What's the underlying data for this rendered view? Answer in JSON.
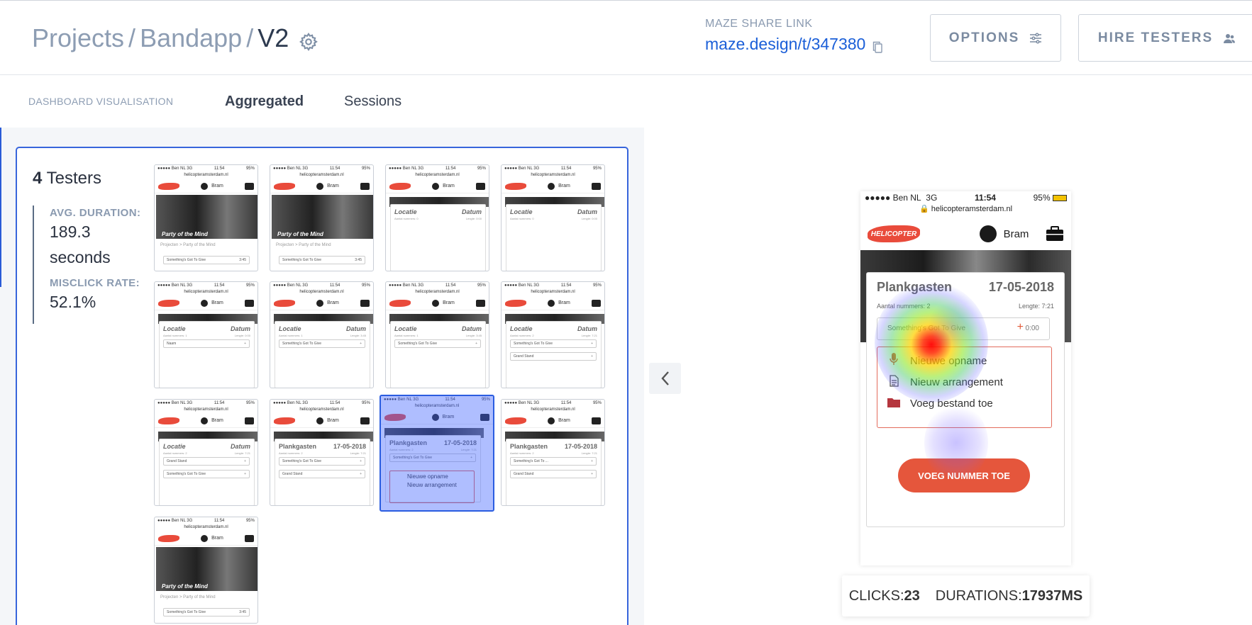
{
  "header": {
    "breadcrumb": [
      "Projects",
      "Bandapp",
      "V2"
    ],
    "breadcrumb_sep": "/",
    "share_label": "MAZE SHARE LINK",
    "share_link": "maze.design/t/347380",
    "options_label": "OPTIONS",
    "hire_label": "HIRE TESTERS"
  },
  "subnav": {
    "section_label": "DASHBOARD VISUALISATION",
    "tabs": [
      {
        "label": "Aggregated",
        "active": true
      },
      {
        "label": "Sessions",
        "active": false
      }
    ]
  },
  "summary": {
    "testers_count": "4",
    "testers_label": "Testers",
    "avg_duration_label": "AVG. DURATION:",
    "avg_duration_value": "189.3",
    "avg_duration_unit": "seconds",
    "misclick_label": "MISCLICK RATE:",
    "misclick_value": "52.1%"
  },
  "thumbnail_common": {
    "carrier": "●●●●● Ben NL",
    "network": "3G",
    "time": "11:54",
    "battery": "95%",
    "url": "helicopteramsterdam.nl",
    "user": "Bram"
  },
  "thumbnails": [
    {
      "type": "hero",
      "caption": "Party of the Mind",
      "breadcrumb": "Projecten > Party of the Mind",
      "row": "Something's Got To Give",
      "row_time": "3:45"
    },
    {
      "type": "hero",
      "caption": "Party of the Mind",
      "breadcrumb": "Projecten > Party of the Mind",
      "row": "Something's Got To Give",
      "row_time": "3:45"
    },
    {
      "type": "card",
      "title": "Locatie",
      "date": "Datum",
      "sub": "Aantal nummers: 0",
      "len": "Lengte: 0:00",
      "rows": []
    },
    {
      "type": "card",
      "title": "Locatie",
      "date": "Datum",
      "sub": "Aantal nummers: 0",
      "len": "Lengte: 0:00",
      "rows": []
    },
    {
      "type": "card",
      "title": "Locatie",
      "date": "Datum",
      "sub": "Aantal nummers: 1",
      "len": "Lengte: 0:00",
      "rows": [
        "Naam"
      ]
    },
    {
      "type": "card",
      "title": "Locatie",
      "date": "Datum",
      "sub": "Aantal nummers: 1",
      "len": "Lengte: 3:45",
      "rows": [
        "Something's Got To Give"
      ]
    },
    {
      "type": "card",
      "title": "Locatie",
      "date": "Datum",
      "sub": "Aantal nummers: 1",
      "len": "Lengte: 3:45",
      "rows": [
        "Something's Got To Give"
      ]
    },
    {
      "type": "card",
      "title": "Locatie",
      "date": "Datum",
      "sub": "Aantal nummers: 2",
      "len": "Lengte: 7:21",
      "rows": [
        "Something's Got To Give",
        "Grand Stand"
      ]
    },
    {
      "type": "card",
      "title": "Locatie",
      "date": "Datum",
      "sub": "Aantal nummers: 2",
      "len": "Lengte: 7:21",
      "rows": [
        "Grand Stand",
        "Something's Got To Give"
      ]
    },
    {
      "type": "card",
      "title": "Plankgasten",
      "date": "17-05-2018",
      "sub": "Aantal nummers: 2",
      "len": "Lengte: 7:21",
      "rows": [
        "Something's Got To Give",
        "Grand Stand"
      ]
    },
    {
      "type": "selected",
      "title": "Plankgasten",
      "date": "17-05-2018",
      "sub": "Aantal nummers: 2",
      "len": "Lengte: 7:21",
      "rows": [
        "Something's Got To Give"
      ],
      "menu": [
        "Nieuwe opname",
        "Nieuw arrangement"
      ]
    },
    {
      "type": "card",
      "title": "Plankgasten",
      "date": "17-05-2018",
      "sub": "Aantal nummers: 2",
      "len": "Lengte: 7:21",
      "rows": [
        "Something's Got To ...",
        "Grand Stand"
      ]
    },
    {
      "type": "hero",
      "caption": "Party of the Mind",
      "breadcrumb": "Projecten > Party of the Mind",
      "row": "Something's Got To Give",
      "row_time": "3:45"
    }
  ],
  "preview": {
    "carrier": "●●●●● Ben NL",
    "network": "3G",
    "time": "11:54",
    "battery": "95%",
    "url": "helicopteramsterdam.nl",
    "user": "Bram",
    "logo_text": "HELICOPTER",
    "title": "Plankgasten",
    "date": "17-05-2018",
    "count": "Aantal nummers: 2",
    "length": "Lengte: 7:21",
    "song": "Something's Got To Give",
    "song_time": "0:00",
    "menu": [
      "Nieuwe opname",
      "Nieuw arrangement",
      "Voeg bestand toe"
    ],
    "button": "VOEG NUMMER TOE"
  },
  "metrics": {
    "clicks_label": "CLICKS:",
    "clicks_value": "23",
    "durations_label": "DURATIONS:",
    "durations_value": "17937MS"
  },
  "colors": {
    "accent": "#3765dc",
    "link": "#1b5fd8",
    "brand": "#e94b3b",
    "muted": "#8d9db3"
  },
  "icons": {
    "settings": "gear-icon",
    "copy": "copy-icon",
    "options": "sliders-icon",
    "hire": "users-icon",
    "prev": "chevron-left-icon"
  }
}
